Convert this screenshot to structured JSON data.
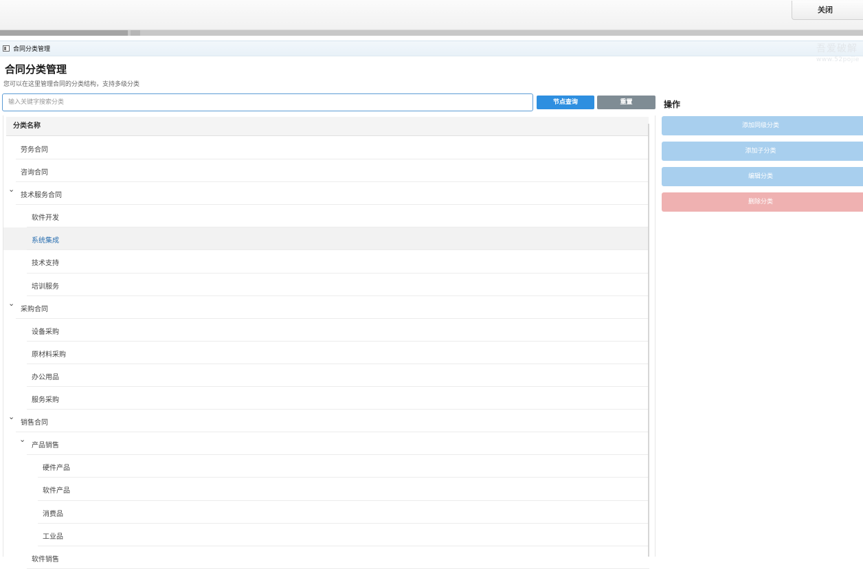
{
  "topbar": {
    "close_label": "关闭"
  },
  "window": {
    "title": "合同分类管理"
  },
  "watermark": {
    "line1": "吾爱破解",
    "line2": "www.52pojie"
  },
  "page": {
    "title": "合同分类管理",
    "subtitle": "您可以在这里管理合同的分类结构，支持多级分类"
  },
  "search": {
    "placeholder": "输入关键字搜索分类",
    "value": "",
    "query_label": "节点查询",
    "reset_label": "重置"
  },
  "tree": {
    "header": "分类名称",
    "rows": [
      {
        "label": "劳务合同",
        "level": 1,
        "expandable": false,
        "selected": false
      },
      {
        "label": "咨询合同",
        "level": 1,
        "expandable": false,
        "selected": false
      },
      {
        "label": "技术服务合同",
        "level": 1,
        "expandable": true,
        "selected": false
      },
      {
        "label": "软件开发",
        "level": 2,
        "expandable": false,
        "selected": false
      },
      {
        "label": "系统集成",
        "level": 2,
        "expandable": false,
        "selected": true
      },
      {
        "label": "技术支持",
        "level": 2,
        "expandable": false,
        "selected": false
      },
      {
        "label": "培训服务",
        "level": 2,
        "expandable": false,
        "selected": false
      },
      {
        "label": "采购合同",
        "level": 1,
        "expandable": true,
        "selected": false
      },
      {
        "label": "设备采购",
        "level": 2,
        "expandable": false,
        "selected": false
      },
      {
        "label": "原材料采购",
        "level": 2,
        "expandable": false,
        "selected": false
      },
      {
        "label": "办公用品",
        "level": 2,
        "expandable": false,
        "selected": false
      },
      {
        "label": "服务采购",
        "level": 2,
        "expandable": false,
        "selected": false
      },
      {
        "label": "销售合同",
        "level": 1,
        "expandable": true,
        "selected": false
      },
      {
        "label": "产品销售",
        "level": 2,
        "expandable": true,
        "selected": false
      },
      {
        "label": "硬件产品",
        "level": 3,
        "expandable": false,
        "selected": false
      },
      {
        "label": "软件产品",
        "level": 3,
        "expandable": false,
        "selected": false
      },
      {
        "label": "消费品",
        "level": 3,
        "expandable": false,
        "selected": false
      },
      {
        "label": "工业品",
        "level": 3,
        "expandable": false,
        "selected": false
      },
      {
        "label": "软件销售",
        "level": 2,
        "expandable": false,
        "selected": false
      }
    ]
  },
  "operations": {
    "title": "操作",
    "buttons": [
      {
        "label": "添加同级分类",
        "name": "add-sibling-category-button",
        "color": "#a8cfee"
      },
      {
        "label": "添加子分类",
        "name": "add-child-category-button",
        "color": "#a8cfee"
      },
      {
        "label": "编辑分类",
        "name": "edit-category-button",
        "color": "#a8cfee"
      },
      {
        "label": "删除分类",
        "name": "delete-category-button",
        "color": "#efb1b1"
      }
    ]
  },
  "colors": {
    "primary": "#2e8fe0",
    "secondary": "#7f8c94",
    "disabled_primary": "#a8cfee",
    "disabled_danger": "#efb1b1",
    "selected_text": "#2a6fb0"
  }
}
